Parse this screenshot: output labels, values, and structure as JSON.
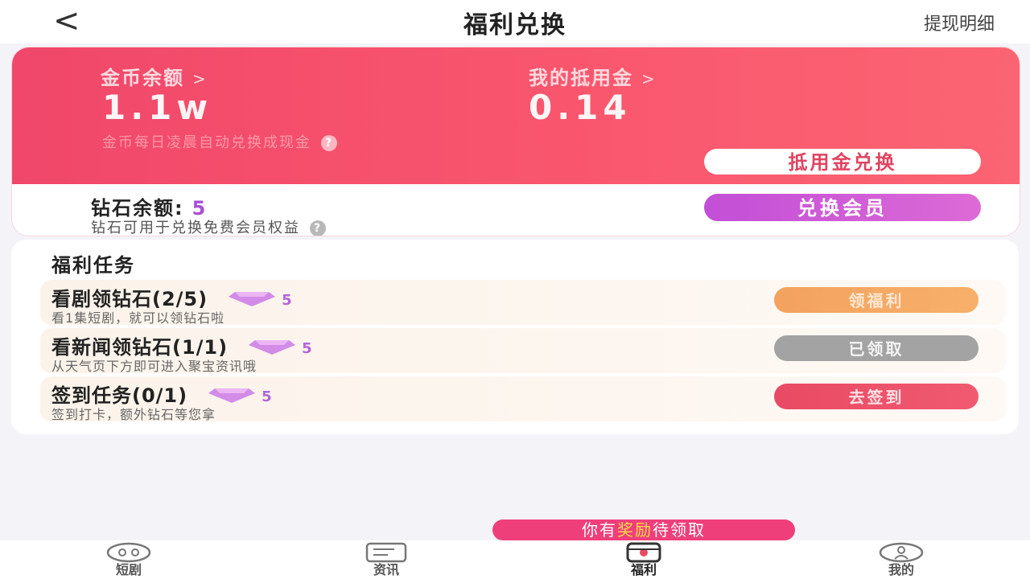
{
  "header": {
    "back_symbol": "<",
    "title": "福利兑换",
    "detail_link": "提现明细"
  },
  "coins": {
    "balance_label": "金币余额",
    "balance_value": "1.1w",
    "voucher_label": "我的抵用金",
    "voucher_value": "0.14",
    "chevron": ">",
    "note": "金币每日凌晨自动兑换成现金",
    "help_symbol": "?",
    "exchange_voucher_button": "抵用金兑换"
  },
  "diamonds": {
    "label": "钻石余额:",
    "count": "5",
    "note": "钻石可用于兑换免费会员权益",
    "help_symbol": "?",
    "exchange_vip_button": "兑换会员"
  },
  "tasks": {
    "section_title": "福利任务",
    "items": [
      {
        "title": "看剧领钻石(2/5)",
        "reward": "5",
        "desc": "看1集短剧，就可以领钻石啦",
        "button": "领福利",
        "state": "claim"
      },
      {
        "title": "看新闻领钻石(1/1)",
        "reward": "5",
        "desc": "从天气页下方即可进入聚宝资讯哦",
        "button": "已领取",
        "state": "done"
      },
      {
        "title": "签到任务(0/1)",
        "reward": "5",
        "desc": "签到打卡，额外钻石等您拿",
        "button": "去签到",
        "state": "sign"
      }
    ]
  },
  "reward_banner": {
    "prefix": "你有",
    "highlight": "奖励",
    "suffix": "待领取"
  },
  "tabbar": {
    "tabs": [
      {
        "label": "短剧",
        "icon": "drama-icon",
        "active": false
      },
      {
        "label": "资讯",
        "icon": "news-icon",
        "active": false
      },
      {
        "label": "福利",
        "icon": "welfare-icon",
        "active": true
      },
      {
        "label": "我的",
        "icon": "profile-icon",
        "active": false
      }
    ]
  },
  "colors": {
    "accent_red": "#f0476a",
    "diamond_purple": "#c24fd6",
    "claim_orange": "#f3a25f",
    "done_gray": "#a3a3a3",
    "banner_pink": "#ef3f7a"
  }
}
